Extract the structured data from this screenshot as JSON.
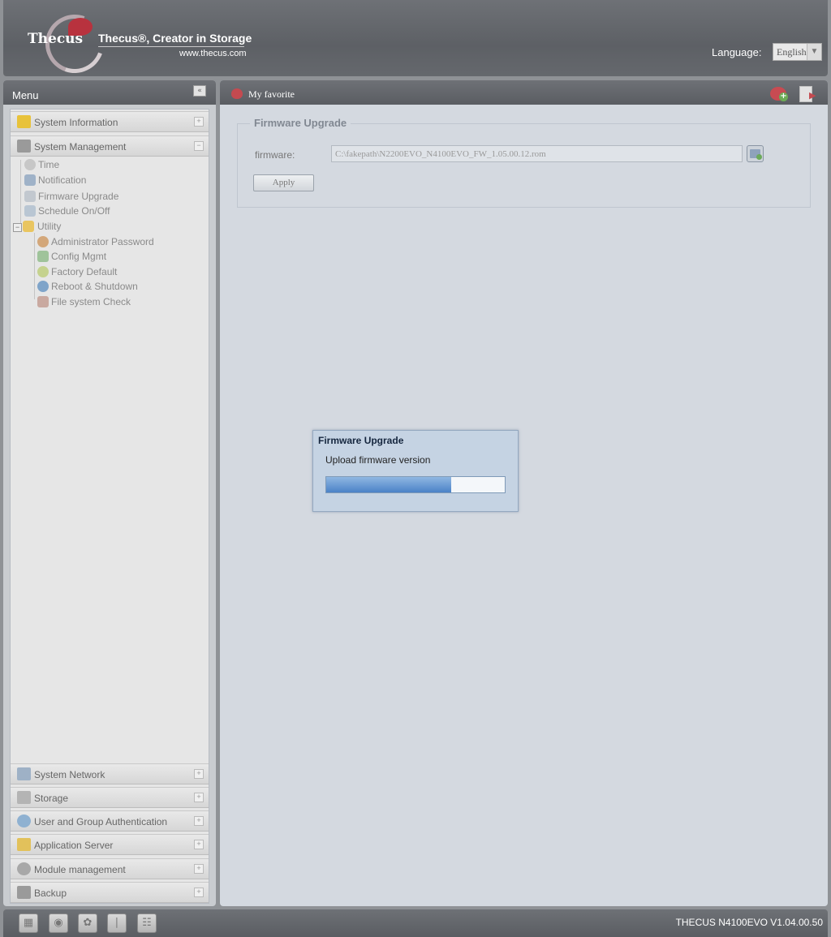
{
  "header": {
    "brand": "Thecus",
    "tagline": "Thecus®, Creator in Storage",
    "website": "www.thecus.com",
    "language_label": "Language:",
    "language_value": "English"
  },
  "menu": {
    "title": "Menu",
    "categories_top": [
      {
        "label": "System Information",
        "icon": "info-icon"
      },
      {
        "label": "System Management",
        "icon": "tools-icon",
        "expanded": true
      }
    ],
    "system_management_items": [
      {
        "label": "Time",
        "icon": "clock-icon"
      },
      {
        "label": "Notification",
        "icon": "notification-icon"
      },
      {
        "label": "Firmware Upgrade",
        "icon": "firmware-icon"
      },
      {
        "label": "Schedule On/Off",
        "icon": "schedule-icon"
      },
      {
        "label": "Utility",
        "icon": "folder-icon"
      }
    ],
    "utility_items": [
      {
        "label": "Administrator Password",
        "icon": "admin-icon"
      },
      {
        "label": "Config Mgmt",
        "icon": "config-icon"
      },
      {
        "label": "Factory Default",
        "icon": "factory-default-icon"
      },
      {
        "label": "Reboot & Shutdown",
        "icon": "power-icon"
      },
      {
        "label": "File system Check",
        "icon": "filesystem-check-icon"
      }
    ],
    "categories_bottom": [
      {
        "label": "System Network",
        "icon": "network-icon"
      },
      {
        "label": "Storage",
        "icon": "storage-icon"
      },
      {
        "label": "User and Group Authentication",
        "icon": "users-icon"
      },
      {
        "label": "Application Server",
        "icon": "app-server-icon"
      },
      {
        "label": "Module management",
        "icon": "module-icon"
      },
      {
        "label": "Backup",
        "icon": "backup-icon"
      }
    ]
  },
  "content": {
    "favorite_label": "My favorite",
    "section_title": "Firmware Upgrade",
    "firmware_label": "firmware:",
    "firmware_value": "C:\\fakepath\\N2200EVO_N4100EVO_FW_1.05.00.12.rom",
    "apply_label": "Apply"
  },
  "dialog": {
    "title": "Firmware Upgrade",
    "message": "Upload firmware version",
    "progress_percent": 70
  },
  "footer": {
    "status_icons": [
      "monitor-icon",
      "disk-icon",
      "fan-icon",
      "temperature-icon",
      "network-tree-icon"
    ],
    "version": "THECUS N4100EVO V1.04.00.50"
  },
  "colors": {
    "header_bg": "#5d6065",
    "content_bg": "#d4d9e0",
    "menu_bg": "#e6e6e6",
    "dialog_bg": "#c5d3e3",
    "progress_fill": "#4b82c7",
    "brand_red": "#b8323e"
  }
}
